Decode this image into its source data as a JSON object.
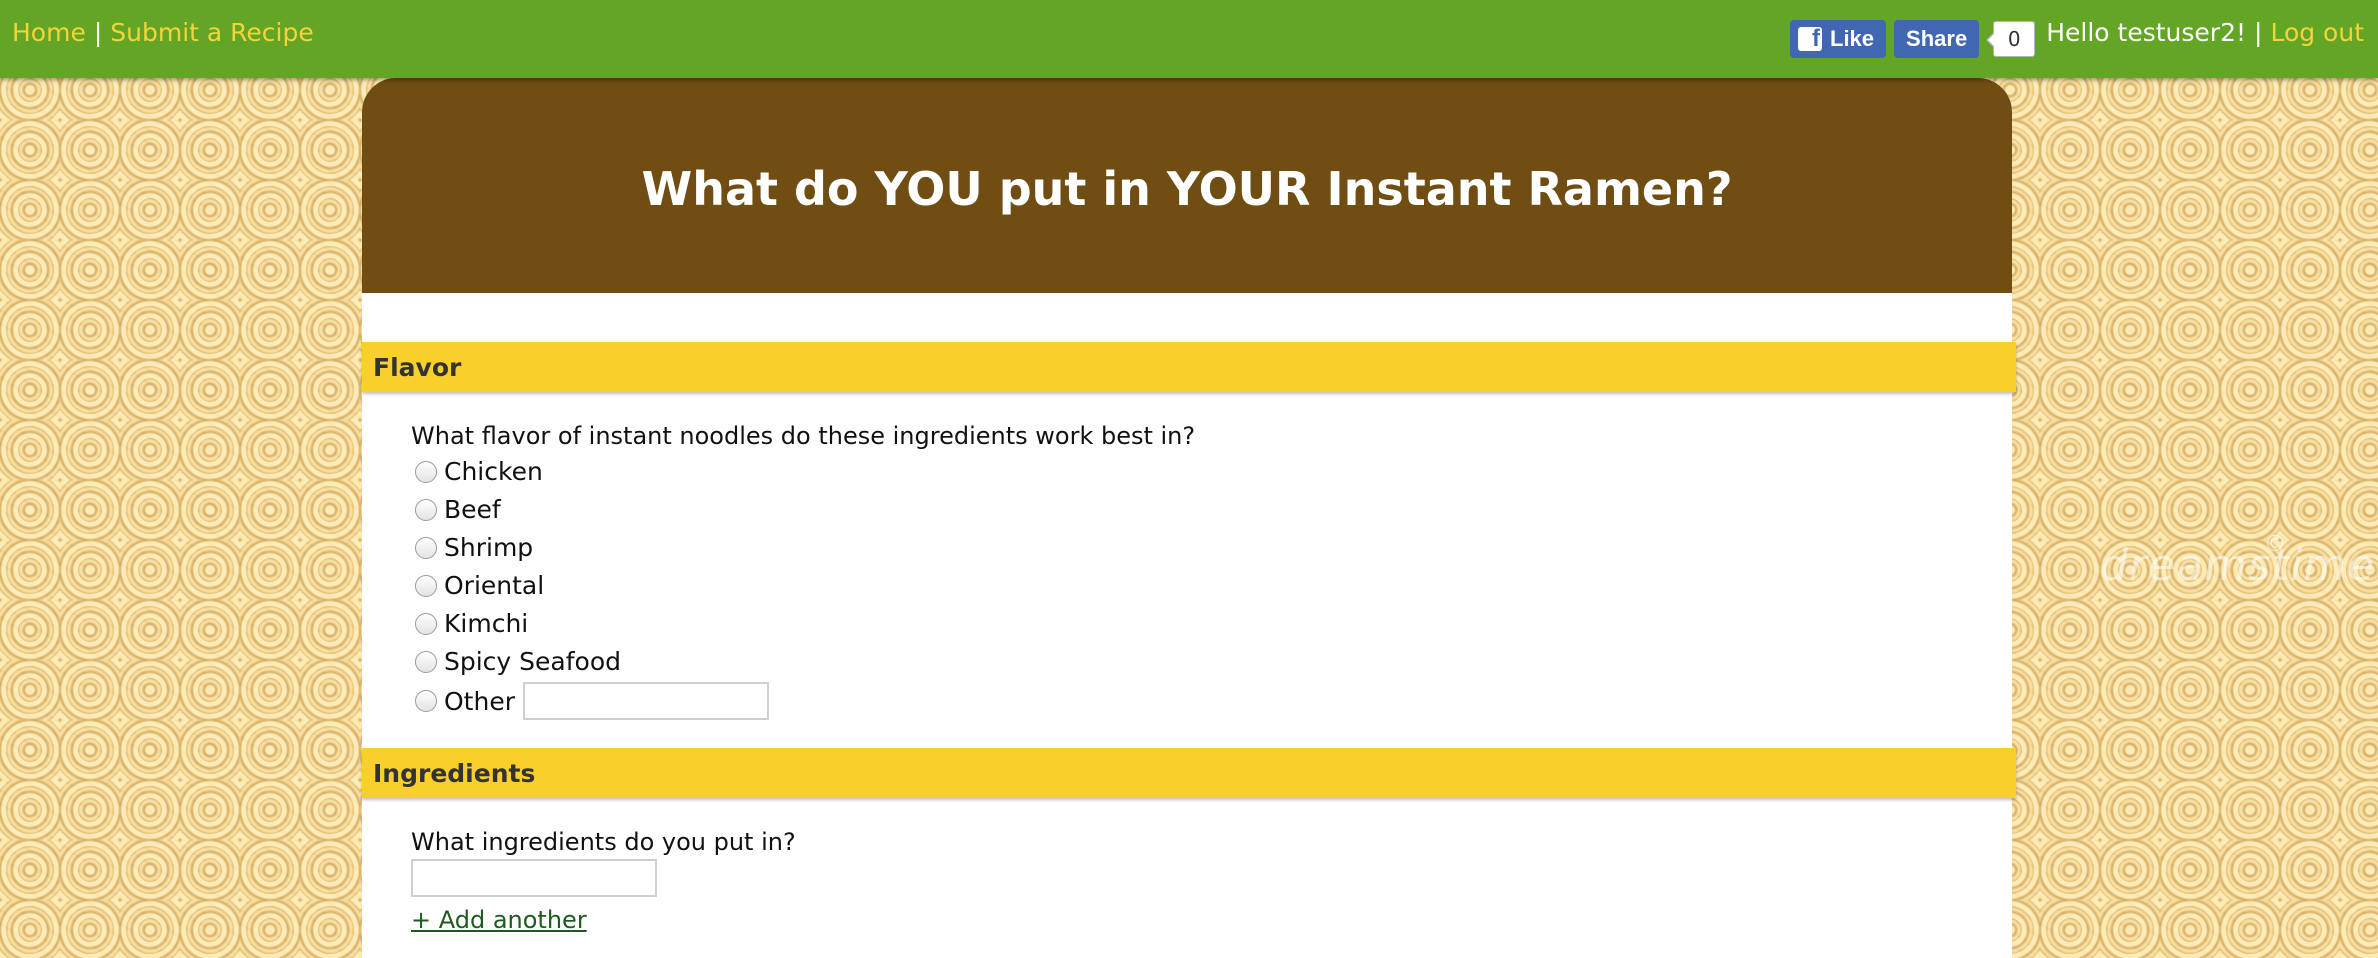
{
  "nav": {
    "home": "Home",
    "separator": "|",
    "submit": "Submit a Recipe",
    "greeting": "Hello testuser2!",
    "logout": "Log out"
  },
  "facebook": {
    "like_label": "Like",
    "share_label": "Share",
    "count": "0",
    "logo_glyph": "f"
  },
  "watermark": {
    "text": "dreamstime.com",
    "symbol": "©"
  },
  "page": {
    "title": "What do YOU put in YOUR Instant Ramen?"
  },
  "flavor": {
    "heading": "Flavor",
    "question": "What flavor of instant noodles do these ingredients work best in?",
    "options": [
      "Chicken",
      "Beef",
      "Shrimp",
      "Oriental",
      "Kimchi",
      "Spicy Seafood",
      "Other"
    ],
    "other_value": ""
  },
  "ingredients": {
    "heading": "Ingredients",
    "question": "What ingredients do you put in?",
    "input_value": "",
    "add_link": "+ Add another"
  },
  "colors": {
    "topbar": "#63a524",
    "link": "#f6d33a",
    "header_brown": "#704d12",
    "section_yellow": "#f8cf2b",
    "facebook_blue": "#4267b2"
  }
}
